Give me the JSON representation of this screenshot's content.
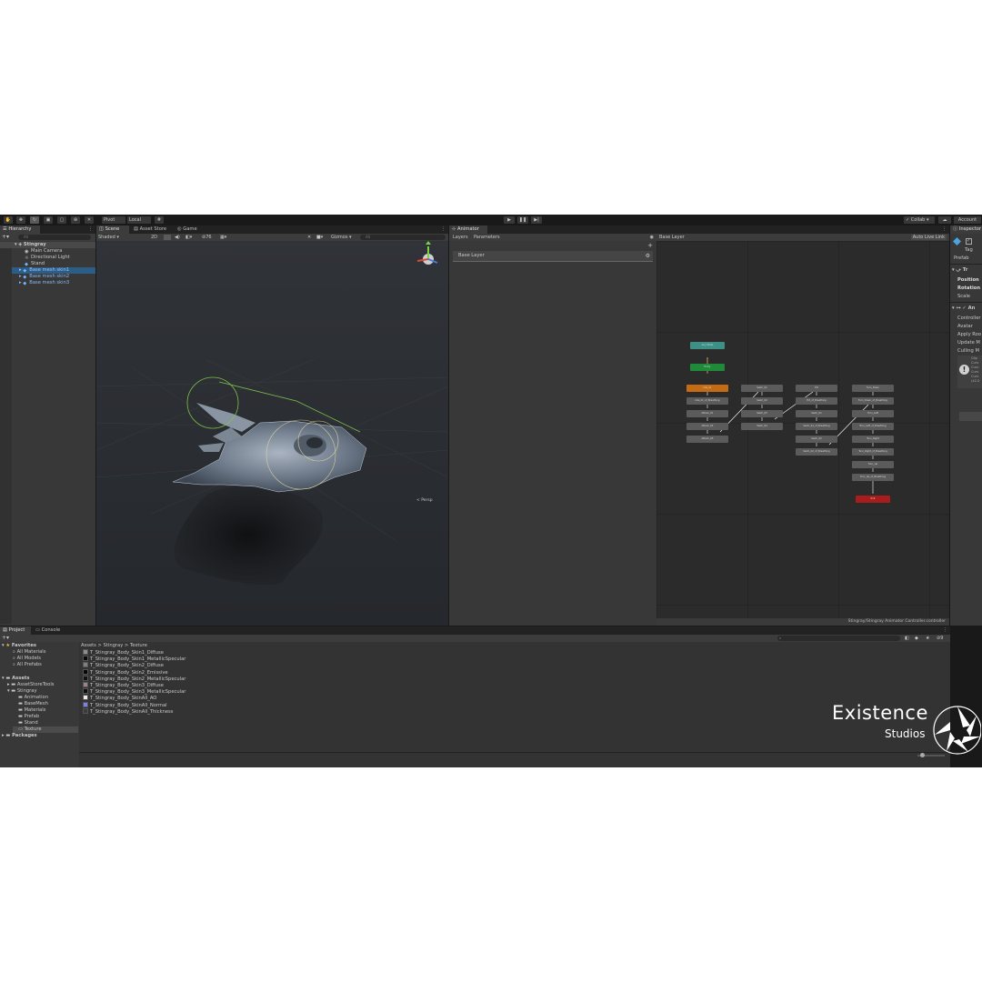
{
  "toolbar": {
    "pivot_label": "Pivot",
    "local_label": "Local",
    "collab_label": "Collab",
    "account_label": "Account"
  },
  "hierarchy": {
    "tab": "Hierarchy",
    "search_placeholder": "All",
    "root": "Stingray",
    "items": [
      "Main Camera",
      "Directional Light",
      "Stand",
      "Base mesh skin1",
      "Base mesh skin2",
      "Base mesh skin3"
    ]
  },
  "scene": {
    "tabs": [
      "Scene",
      "Asset Store",
      "Game"
    ],
    "shading": "Shaded",
    "mode_2d": "2D",
    "layers_count": "76",
    "gizmos": "Gizmos",
    "search_placeholder": "All",
    "persp": "< Persp"
  },
  "animator": {
    "tab": "Animator",
    "subtabs": [
      "Layers",
      "Parameters"
    ],
    "breadcrumb": "Base Layer",
    "auto_live_link": "Auto Live Link",
    "layer_name": "Base Layer",
    "footer_path": "Stingray/Stingray Animator Controller.controller"
  },
  "inspector": {
    "tab": "Inspector",
    "tag_label": "Tag",
    "prefab_label": "Prefab",
    "transform_header": "Tr",
    "animator_header": "An",
    "fields": [
      "Position",
      "Rotation",
      "Scale"
    ],
    "animator_fields": [
      "Controller",
      "Avatar",
      "Apply Roo",
      "Update M",
      "Culling M"
    ],
    "info_lines": [
      "Clip",
      "Curv",
      "Curv",
      "Curv",
      "Curv",
      "(42.0"
    ]
  },
  "project": {
    "tabs": [
      "Project",
      "Console"
    ],
    "favorites_label": "Favorites",
    "favorites": [
      "All Materials",
      "All Models",
      "All Prefabs"
    ],
    "assets_label": "Assets",
    "assets_tree": [
      "AssetStoreTools",
      "Stingray"
    ],
    "stingray_children": [
      "Animation",
      "BaseMesh",
      "Materials",
      "Prefab",
      "Stand",
      "Texture"
    ],
    "packages_label": "Packages",
    "breadcrumb": [
      "Assets",
      "Stingray",
      "Texture"
    ],
    "files": [
      {
        "name": "T_Stingray_Body_Skin1_Diffuse",
        "color": "#8a8f96"
      },
      {
        "name": "T_Stingray_Body_Skin1_MetallicSpecular",
        "color": "#0a0a0a"
      },
      {
        "name": "T_Stingray_Body_Skin2_Diffuse",
        "color": "#7e7e7e"
      },
      {
        "name": "T_Stingray_Body_Skin2_Emissive",
        "color": "#050505"
      },
      {
        "name": "T_Stingray_Body_Skin2_MetallicSpecular",
        "color": "#111111"
      },
      {
        "name": "T_Stingray_Body_Skin3_Diffuse",
        "color": "#9a8288"
      },
      {
        "name": "T_Stingray_Body_Skin3_MetallicSpecular",
        "color": "#0d0d0d"
      },
      {
        "name": "T_Stingray_Body_SkinAll_AO",
        "color": "#e9e9e9"
      },
      {
        "name": "T_Stingray_Body_SkinAll_Normal",
        "color": "#7b7ff0"
      },
      {
        "name": "T_Stingray_Body_SkinAll_Thickness",
        "color": "#3b3b3b"
      }
    ],
    "asset_count": "9"
  },
  "graph": {
    "any_state": "Any State",
    "entry": "Entry",
    "exit": "Exit",
    "col1": [
      "Idle_01",
      "Idle_01_of_Breathing",
      "Attack_01",
      "Attack_02",
      "Attack_03"
    ],
    "col2": [
      "Swim_01",
      "Swim_02",
      "Swim_03",
      "Swim_04"
    ],
    "col3": [
      "Hit",
      "Hit_of_Breathing",
      "Swim_01",
      "Swim_01_of_Breathing",
      "Swim_02",
      "Swim_02_of_Breathing"
    ],
    "col4": [
      "Turn_Down",
      "Turn_Down_of_Breathing",
      "Turn_Left",
      "Turn_Left_of_Breathing",
      "Turn_Right",
      "Turn_Right_of_Breathing",
      "Turn_Up",
      "Turn_Up_of_Breathing"
    ]
  },
  "watermark": {
    "brand": "Existence",
    "sub": "Studios"
  },
  "colors": {
    "orange_state": "#c56b13",
    "entry_state": "#1f8a3a",
    "any_state": "#3e8f86",
    "exit_state": "#a81c1c",
    "selected_row": "#2c5d87"
  }
}
